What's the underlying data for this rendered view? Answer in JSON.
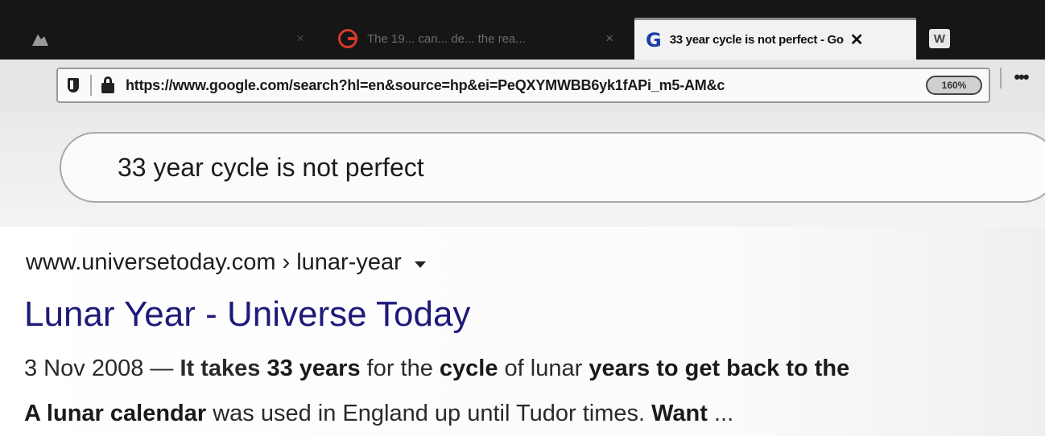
{
  "browser": {
    "tabs": [
      {
        "title": "",
        "icon": "mountain-image-icon"
      },
      {
        "title": "The 19... can... de... the rea...",
        "icon": "google-icon"
      },
      {
        "title": "33 year cycle is not perfect - Go",
        "icon": "google-g-icon",
        "active": true
      },
      {
        "title": "",
        "icon": "w-icon",
        "glyph": "W"
      }
    ],
    "close_glyph": "×",
    "active_close_glyph": "✕",
    "url": "https://www.google.com/search?hl=en&source=hp&ei=PeQXYMWBB6yk1fAPi_m5-AM&c",
    "zoom": "160%",
    "menu_glyph": "•••"
  },
  "search": {
    "query": "33 year cycle is not perfect"
  },
  "result": {
    "domain": "www.universetoday.com",
    "separator": "›",
    "path": "lunar-year",
    "title": "Lunar Year - Universe Today",
    "snippet_line1": {
      "date": "3 Nov 2008 — ",
      "p1": "It takes ",
      "b1": "33 years",
      "p2": " for the ",
      "b2": "cycle",
      "p3": " of lunar ",
      "b3": "years",
      "p4": " to get back to the"
    },
    "snippet_line2": {
      "b1": "A lunar calendar",
      "p1": " was used in England up until Tudor times. ",
      "b2": "Want",
      "p2": " ..."
    }
  },
  "colors": {
    "title_link": "#1d1a7a",
    "tabstrip": "#161616"
  }
}
